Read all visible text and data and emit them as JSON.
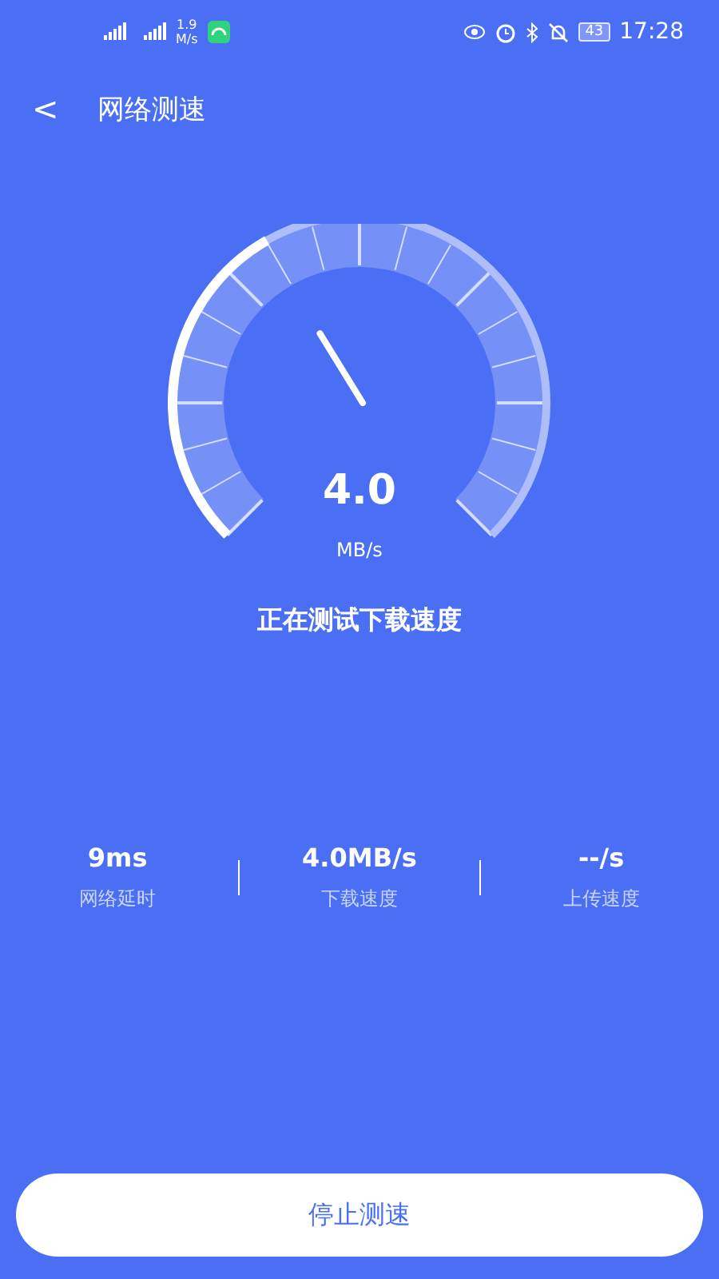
{
  "status_bar": {
    "net_speed": "1.9",
    "net_unit": "M/s",
    "battery": "43",
    "time": "17:28"
  },
  "header": {
    "back": "<",
    "title": "网络测速"
  },
  "gauge": {
    "value": "4.0",
    "unit": "MB/s"
  },
  "status_text": "正在测试下载速度",
  "stats": [
    {
      "value": "9ms",
      "label": "网络延时"
    },
    {
      "value": "4.0MB/s",
      "label": "下载速度"
    },
    {
      "value": "--/s",
      "label": "上传速度"
    }
  ],
  "button": "停止测速"
}
